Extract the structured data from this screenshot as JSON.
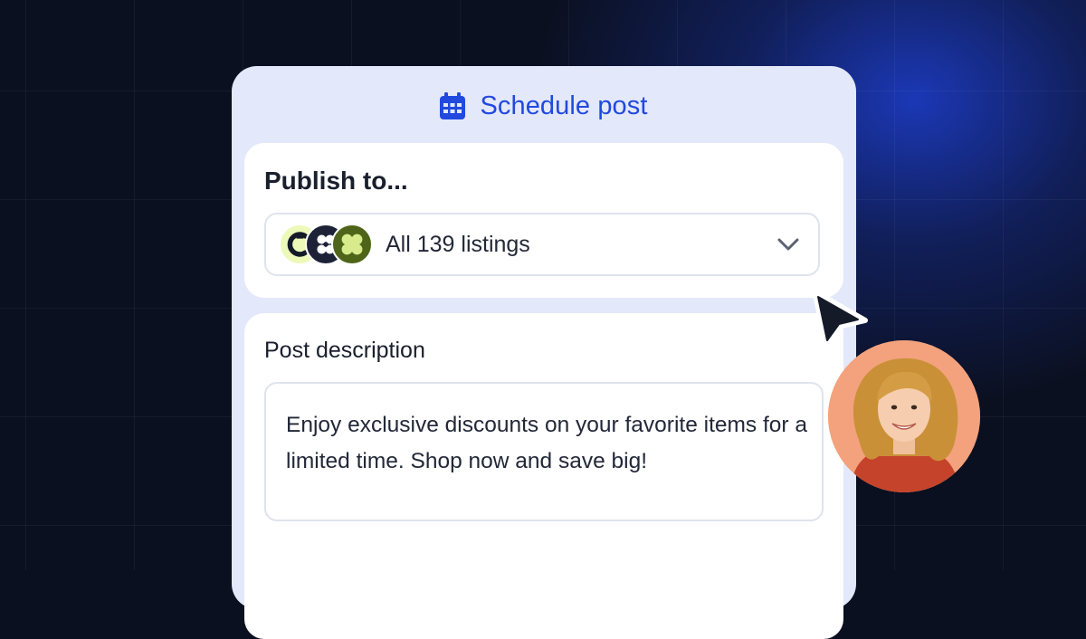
{
  "colors": {
    "background": "#0b1020",
    "accent": "#2149de",
    "panel": "#e3e8fb",
    "card": "#ffffff"
  },
  "header": {
    "icon": "calendar-icon",
    "title": "Schedule post"
  },
  "publish": {
    "label": "Publish to...",
    "selected_value": "All 139 listings",
    "avatars": [
      "listing-logo-1",
      "listing-logo-2",
      "listing-logo-3"
    ],
    "dropdown_icon": "chevron-down-icon"
  },
  "description": {
    "label": "Post description",
    "value": "Enjoy exclusive discounts on your favorite items for a limited time. Shop now and save big!"
  },
  "overlay": {
    "cursor_icon": "mouse-pointer-icon",
    "user_avatar": "user-avatar"
  }
}
